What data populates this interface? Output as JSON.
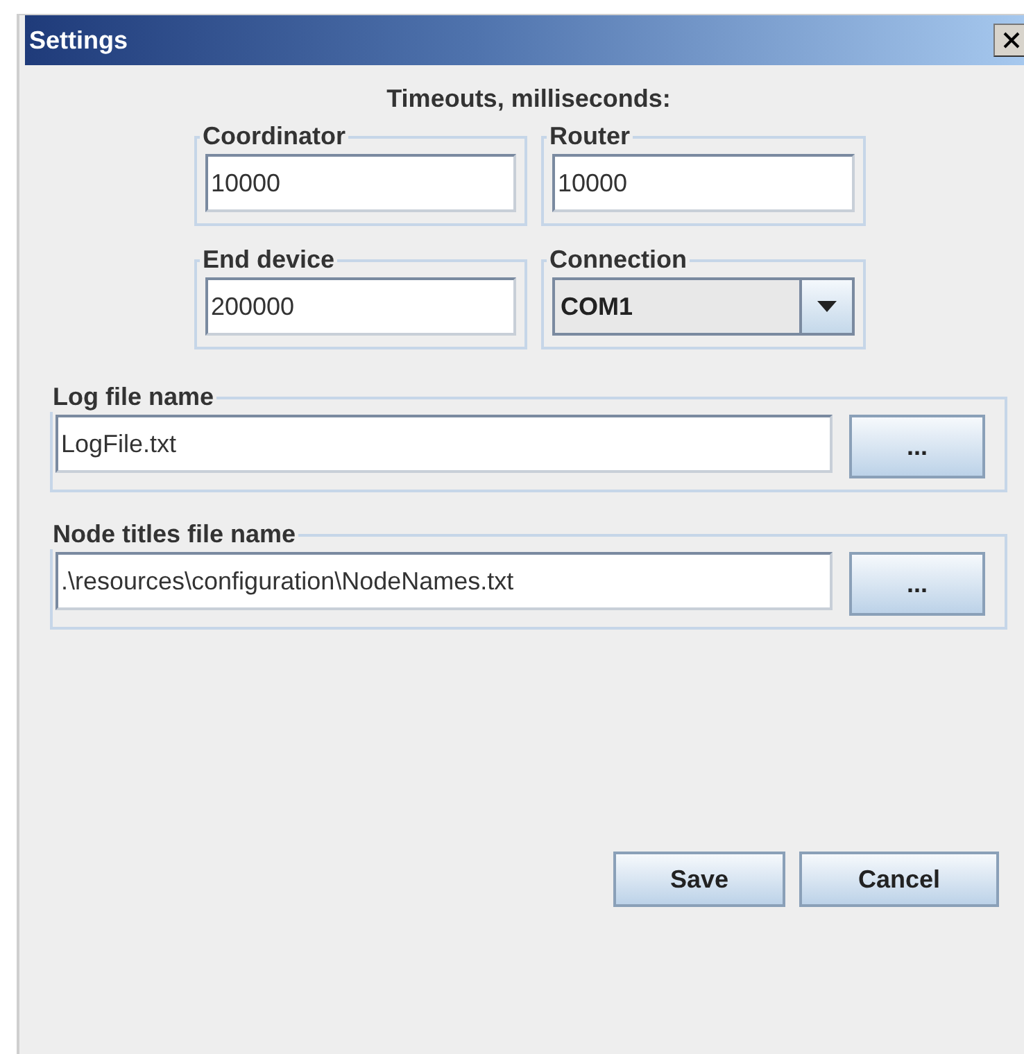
{
  "window": {
    "title": "Settings"
  },
  "heading": "Timeouts, milliseconds:",
  "timeouts": [
    {
      "label": "Coordinator",
      "kind": "text",
      "value": "10000"
    },
    {
      "label": "Router",
      "kind": "text",
      "value": "10000"
    },
    {
      "label": "End device",
      "kind": "text",
      "value": "200000"
    },
    {
      "label": "Connection",
      "kind": "combo",
      "value": "COM1"
    }
  ],
  "files": [
    {
      "label": "Log file name",
      "value": "LogFile.txt",
      "button": "..."
    },
    {
      "label": "Node titles file name",
      "value": ".\\resources\\configuration\\NodeNames.txt",
      "button": "..."
    }
  ],
  "buttons": [
    "Save",
    "Cancel"
  ]
}
